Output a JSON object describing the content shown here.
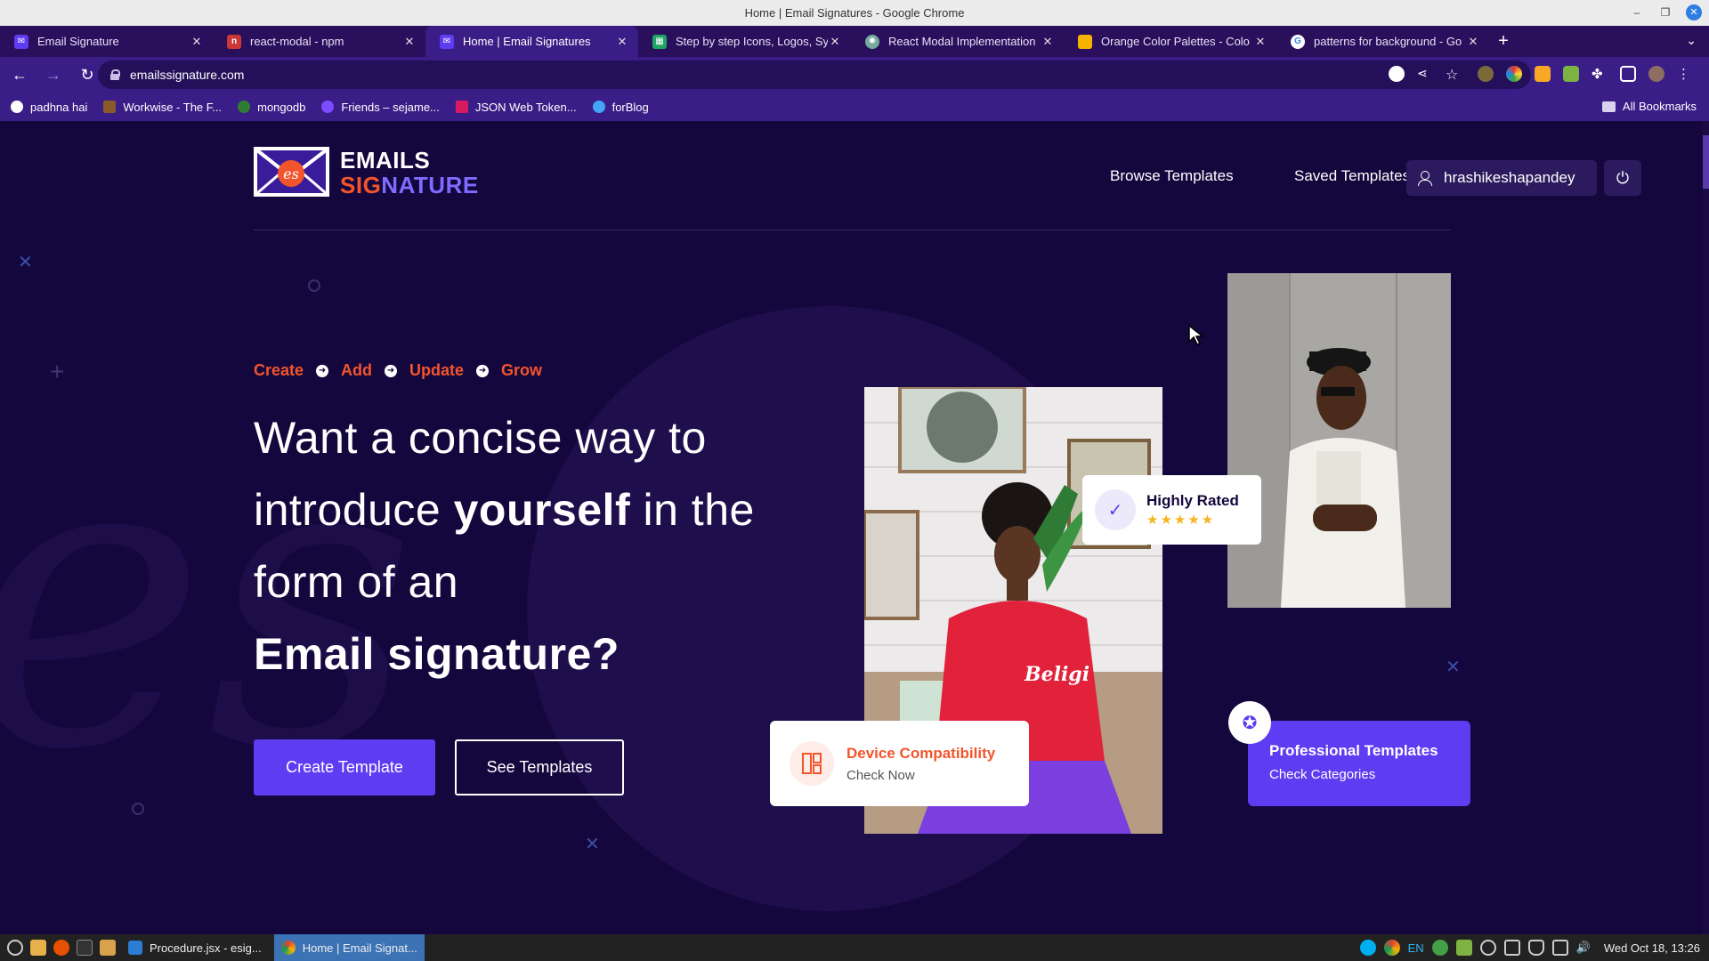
{
  "window": {
    "title": "Home | Email Signatures - Google Chrome"
  },
  "tabs": [
    {
      "title": "Email Signature",
      "favicon": "purple-logo-icon",
      "active": false
    },
    {
      "title": "react-modal - npm",
      "favicon": "npm-icon",
      "active": false
    },
    {
      "title": "Home | Email Signatures",
      "favicon": "purple-logo-icon",
      "active": true
    },
    {
      "title": "Step by step Icons, Logos, Sy",
      "favicon": "green-sheet-icon",
      "active": false
    },
    {
      "title": "React Modal Implementation",
      "favicon": "openai-icon",
      "active": false
    },
    {
      "title": "Orange Color Palettes - Colo",
      "favicon": "palette-icon",
      "active": false
    },
    {
      "title": "patterns for background - Go",
      "favicon": "google-icon",
      "active": false
    }
  ],
  "toolbar": {
    "url": "emailssignature.com"
  },
  "bookmarks": [
    {
      "label": "padhna hai",
      "color": "#ffffff"
    },
    {
      "label": "Workwise - The F...",
      "color": "#8a5a2b"
    },
    {
      "label": "mongodb",
      "color": "#2e7d32"
    },
    {
      "label": "Friends – sejame...",
      "color": "#7c4dff"
    },
    {
      "label": "JSON Web Token...",
      "color": "#d81b60"
    },
    {
      "label": "forBlog",
      "color": "#42a5f5"
    }
  ],
  "all_bookmarks_label": "All Bookmarks",
  "site": {
    "logo_line1": "EMAILS",
    "logo_line2a": "SIG",
    "logo_line2b": "NATURE",
    "nav": {
      "browse": "Browse Templates",
      "saved": "Saved Templates"
    },
    "username": "hrashikeshapandey",
    "steps": [
      "Create",
      "Add",
      "Update",
      "Grow"
    ],
    "headline": {
      "line1": "Want a concise way to",
      "line2_pre": "introduce ",
      "line2_bold": "yourself",
      "line2_post": " in the",
      "line3": "form of an",
      "line4": "Email signature?"
    },
    "buttons": {
      "create": "Create Template",
      "see": "See Templates"
    },
    "cards": {
      "rated": {
        "title": "Highly Rated",
        "stars": "★★★★★"
      },
      "device": {
        "title": "Device Compatibility",
        "sub": "Check Now"
      },
      "pro": {
        "title": "Professional Templates",
        "sub": "Check Categories"
      }
    },
    "colors": {
      "accent": "#5e3cf2",
      "orange": "#f2552c",
      "background": "#14073d"
    }
  },
  "taskbar": {
    "tasks": [
      {
        "label": "Procedure.jsx - esig...",
        "active": false
      },
      {
        "label": "Home | Email Signat...",
        "active": true
      }
    ],
    "lang": "EN",
    "clock": "Wed Oct 18, 13:26"
  }
}
